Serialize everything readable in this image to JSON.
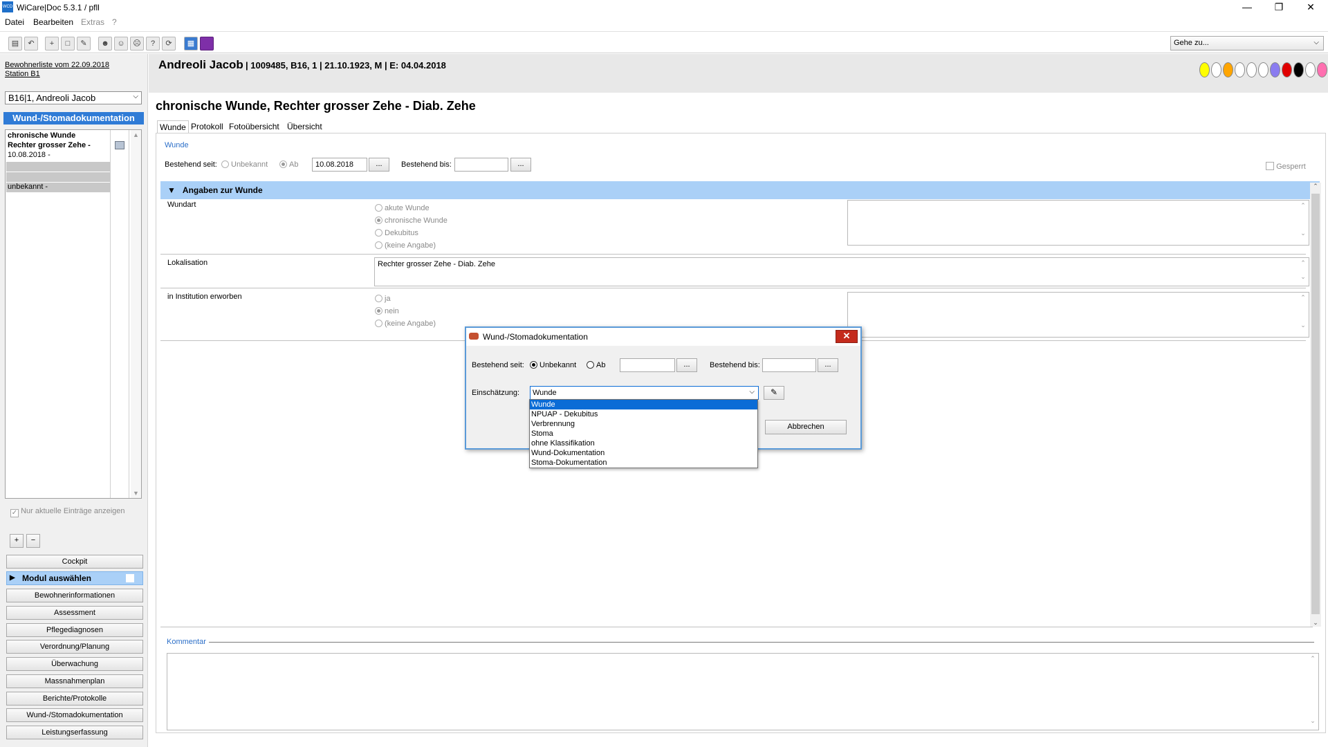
{
  "window": {
    "title": "WiCare|Doc 5.3.1  / pfll",
    "app_icon_text": "WCD",
    "minimize": "—",
    "restore": "❐",
    "close": "✕"
  },
  "menu": [
    "Datei",
    "Bearbeiten",
    "Extras",
    "?"
  ],
  "toolbar": {
    "goto_placeholder": "Gehe zu..."
  },
  "left": {
    "list_link": "Bewohnerliste vom 22.09.2018",
    "station_link": "Station B1",
    "resident_select": "B16|1, Andreoli Jacob",
    "module_title": "Wund-/Stomadokumentation",
    "wound_entry_line1": "chronische Wunde",
    "wound_entry_line2": "Rechter grosser Zehe  -",
    "wound_entry_date": "10.08.2018 -",
    "unknown_entry": "unbekannt -",
    "only_current_label": "Nur aktuelle Einträge anzeigen",
    "add": "+",
    "remove": "−",
    "nav": [
      "Cockpit",
      "Modul auswählen",
      "Bewohnerinformationen",
      "Assessment",
      "Pflegediagnosen",
      "Verordnung/Planung",
      "Überwachung",
      "Massnahmenplan",
      "Berichte/Protokolle",
      "Wund-/Stomadokumentation",
      "Leistungserfassung"
    ]
  },
  "patient": {
    "name": "Andreoli Jacob",
    "details": "| 1009485, B16, 1 | 21.10.1923, M | E: 04.04.2018",
    "dot_colors": [
      "#ffff00",
      "#ffffff",
      "#ffa500",
      "#ffffff",
      "#ffffff",
      "#ffffff",
      "#8a7cf0",
      "#e00000",
      "#000000",
      "#ffffff",
      "#ff6fb0"
    ]
  },
  "content": {
    "wound_title": "chronische Wunde, Rechter grosser Zehe  - Diab. Zehe",
    "tabs": [
      "Wunde",
      "Protokoll",
      "Fotoübersicht",
      "Übersicht"
    ],
    "section_label": "Wunde",
    "bestehend_seit_label": "Bestehend seit:",
    "unbekannt": "Unbekannt",
    "ab": "Ab",
    "date_from": "10.08.2018",
    "dots": "...",
    "bestehend_bis_label": "Bestehend bis:",
    "gesperrt": "Gesperrt",
    "angaben_header": "Angaben zur Wunde",
    "wundart_label": "Wundart",
    "wundart_options": [
      "akute Wunde",
      "chronische Wunde",
      "Dekubitus",
      "(keine Angabe)"
    ],
    "lokalisation_label": "Lokalisation",
    "lokalisation_value": "Rechter grosser Zehe  - Diab. Zehe",
    "institution_label": "in Institution erworben",
    "institution_options": [
      "ja",
      "nein",
      "(keine Angabe)"
    ],
    "kommentar_label": "Kommentar"
  },
  "dialog": {
    "title": "Wund-/Stomadokumentation",
    "bestehend_seit_label": "Bestehend seit:",
    "unbekannt": "Unbekannt",
    "ab": "Ab",
    "dots": "...",
    "bestehend_bis_label": "Bestehend bis:",
    "einschaetzung_label": "Einschätzung:",
    "einschaetzung_value": "Wunde",
    "options": [
      "Wunde",
      "NPUAP - Dekubitus",
      "Verbrennung",
      "Stoma",
      "ohne Klassifikation",
      "Wund-Dokumentation",
      "Stoma-Dokumentation"
    ],
    "cancel": "Abbrechen"
  }
}
